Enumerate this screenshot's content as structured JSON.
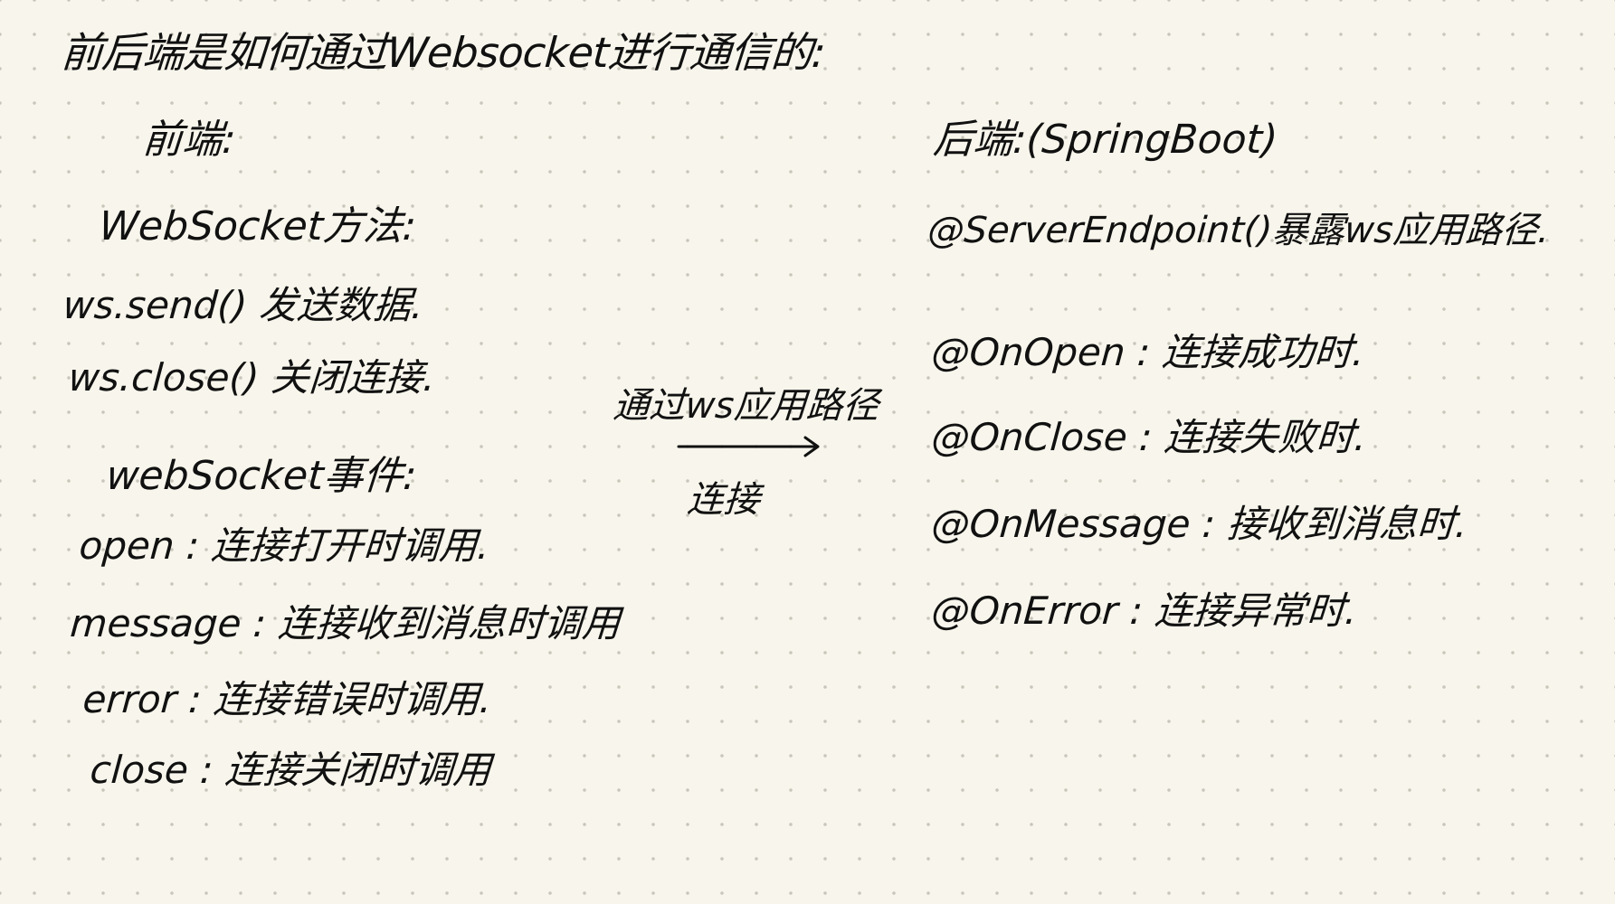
{
  "title": "前后端是如何通过Websocket进行通信的:",
  "frontend": {
    "heading": "前端:",
    "methods_heading": "WebSocket方法:",
    "methods": [
      "ws.send() 发送数据.",
      "ws.close() 关闭连接."
    ],
    "events_heading": "webSocket事件:",
    "events": [
      "open : 连接打开时调用.",
      "message : 连接收到消息时调用",
      "error : 连接错误时调用.",
      "close : 连接关闭时调用"
    ]
  },
  "connection": {
    "top_label": "通过ws应用路径",
    "bottom_label": "连接"
  },
  "backend": {
    "heading": "后端:(SpringBoot)",
    "endpoint": "@ServerEndpoint()暴露ws应用路径.",
    "annotations": [
      "@OnOpen : 连接成功时.",
      "@OnClose : 连接失败时.",
      "@OnMessage : 接收到消息时.",
      "@OnError : 连接异常时."
    ]
  },
  "colors": {
    "background": "#f8f6ec",
    "dots": "#c9c6bb",
    "ink": "#111111"
  }
}
